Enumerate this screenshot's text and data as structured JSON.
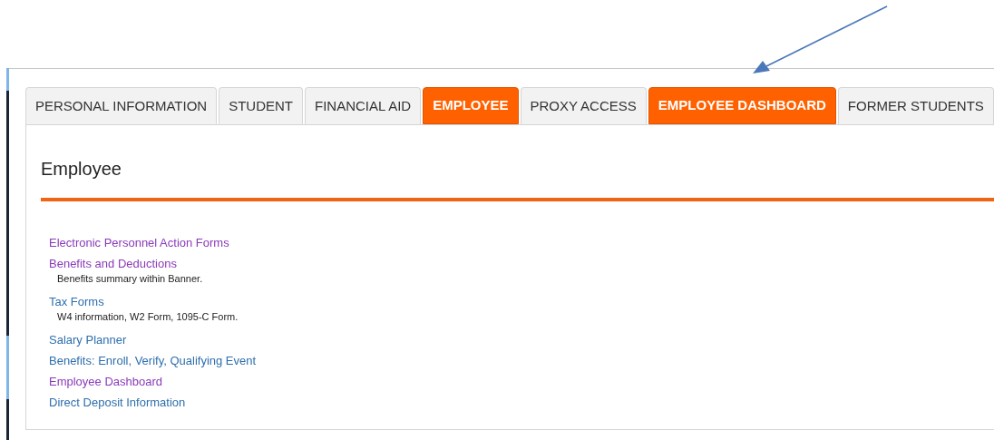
{
  "tabs": [
    {
      "label": "PERSONAL INFORMATION",
      "selected": false
    },
    {
      "label": "STUDENT",
      "selected": false
    },
    {
      "label": "FINANCIAL AID",
      "selected": false
    },
    {
      "label": "EMPLOYEE",
      "selected": true
    },
    {
      "label": "PROXY ACCESS",
      "selected": false
    },
    {
      "label": "EMPLOYEE DASHBOARD",
      "selected": true
    },
    {
      "label": "FORMER STUDENTS",
      "selected": false
    }
  ],
  "heading": "Employee",
  "links": [
    {
      "label": "Electronic Personnel Action Forms",
      "visited": true
    },
    {
      "label": "Benefits and Deductions",
      "visited": true,
      "description": "Benefits summary within Banner."
    },
    {
      "label": "Tax Forms",
      "visited": false,
      "description": "W4 information, W2 Form, 1095-C Form."
    },
    {
      "label": "Salary Planner",
      "visited": false
    },
    {
      "label": "Benefits: Enroll, Verify, Qualifying Event",
      "visited": false
    },
    {
      "label": "Employee Dashboard",
      "visited": true
    },
    {
      "label": "Direct Deposit Information",
      "visited": false
    }
  ]
}
